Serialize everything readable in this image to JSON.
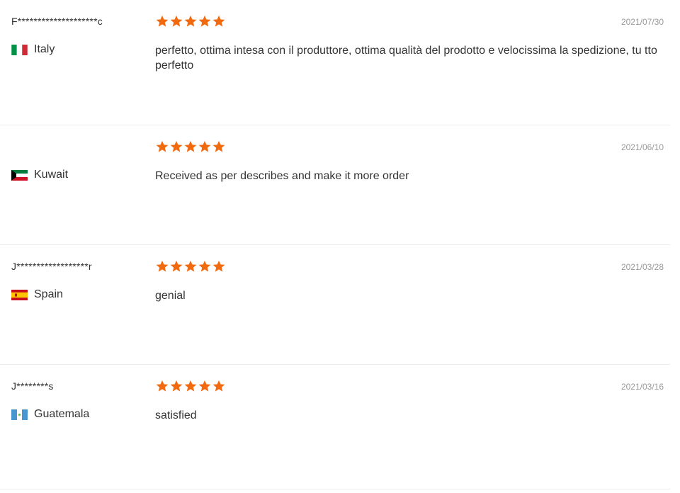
{
  "colors": {
    "star": "#f26a10",
    "date": "#999999",
    "text": "#333333",
    "divider": "#ececec"
  },
  "reviews": [
    {
      "user": "F********************c",
      "country": "Italy",
      "flag_icon": "italy-flag-icon",
      "stars": 5,
      "date": "2021/07/30",
      "text": "perfetto, ottima intesa con il produttore, ottima qualità del prodotto e velocissima la spedizione, tu tto perfetto"
    },
    {
      "user": "",
      "country": "Kuwait",
      "flag_icon": "kuwait-flag-icon",
      "stars": 5,
      "date": "2021/06/10",
      "text": "Received as per describes and make it more order"
    },
    {
      "user": "J******************r",
      "country": "Spain",
      "flag_icon": "spain-flag-icon",
      "stars": 5,
      "date": "2021/03/28",
      "text": "genial"
    },
    {
      "user": "J********s",
      "country": "Guatemala",
      "flag_icon": "guatemala-flag-icon",
      "stars": 5,
      "date": "2021/03/16",
      "text": "satisfied"
    }
  ]
}
